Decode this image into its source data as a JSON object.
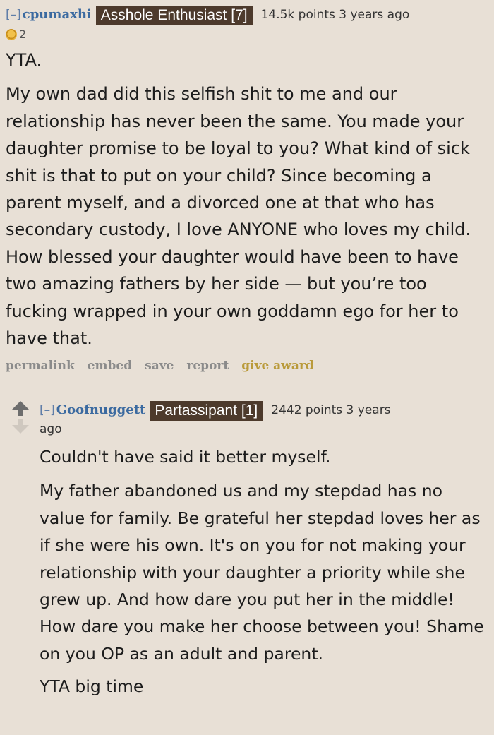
{
  "comment1": {
    "toggle": "[–]",
    "author": "cpumaxhi",
    "flair": "Asshole Enthusiast [7]",
    "score": "14.5k points 3 years ago",
    "award_icon": "gold-award-icon",
    "award_count": "2",
    "paragraphs": [
      "YTA.",
      "My own dad did this selfish shit to me and our relationship has never been the same. You made your daughter promise to be loyal to you? What kind of sick shit is that to put on your child? Since becoming a parent myself, and a divorced one at that who has secondary custody, I love ANYONE who loves my child. How blessed your daughter would have been to have two amazing fathers by her side — but you’re too fucking wrapped in your own goddamn ego for her to have that."
    ],
    "buttons": {
      "permalink": "permalink",
      "embed": "embed",
      "save": "save",
      "report": "report",
      "give_award": "give award"
    }
  },
  "comment2": {
    "toggle": "[–]",
    "author": "Goofnuggett",
    "flair": "Partassipant [1]",
    "score": "2442 points 3 years",
    "score_cont": "ago",
    "paragraphs": [
      "Couldn't have said it better myself.",
      "My father abandoned us and my stepdad has no value for family. Be grateful her stepdad loves her as if she were his own. It's on you for not making your relationship with your daughter a priority while she grew up. And how dare you put her in the middle! How dare you make her choose between you! Shame on you OP as an adult and parent.",
      "YTA big time"
    ]
  },
  "colors": {
    "background": "#e8e0d6",
    "author_link": "#3b6aa0",
    "flair_bg": "#4d3a2c",
    "button_text": "#8b8b8b",
    "give_award": "#b99a3a"
  }
}
